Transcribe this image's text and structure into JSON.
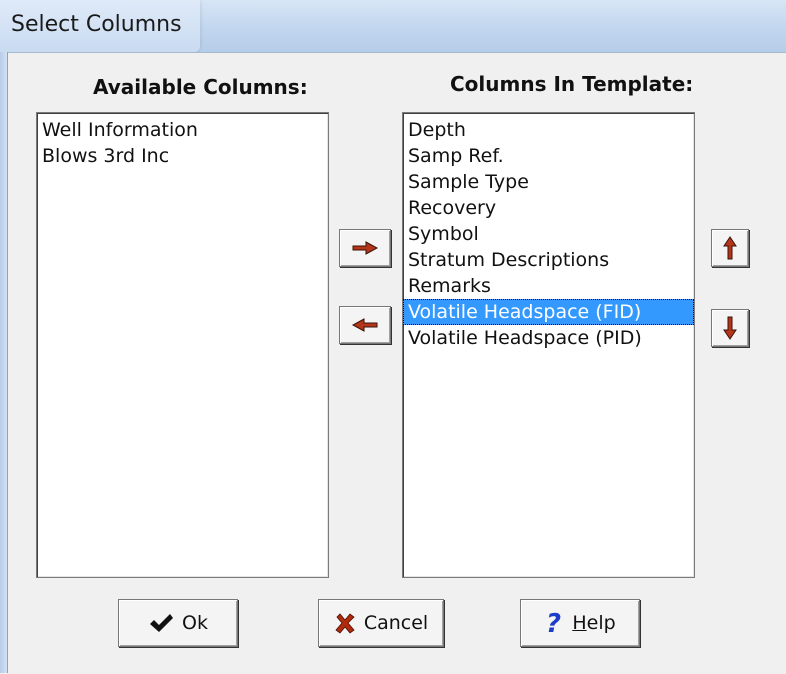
{
  "window": {
    "title": "Select Columns"
  },
  "available": {
    "label": "Available Columns:",
    "items": [
      "Well Information",
      "Blows 3rd Inc"
    ]
  },
  "template": {
    "label": "Columns In Template:",
    "items": [
      "Depth",
      "Samp Ref.",
      "Sample Type",
      "Recovery",
      "Symbol",
      "Stratum Descriptions",
      "Remarks",
      "Volatile Headspace (FID)",
      "Volatile Headspace (PID)"
    ],
    "selected_item": "Volatile Headspace (FID)"
  },
  "buttons": {
    "ok": "Ok",
    "cancel": "Cancel",
    "help_prefix": "",
    "help_mnemonic": "H",
    "help_rest": "elp"
  },
  "colors": {
    "arrow": "#b4351a",
    "selection": "#3399ff"
  }
}
